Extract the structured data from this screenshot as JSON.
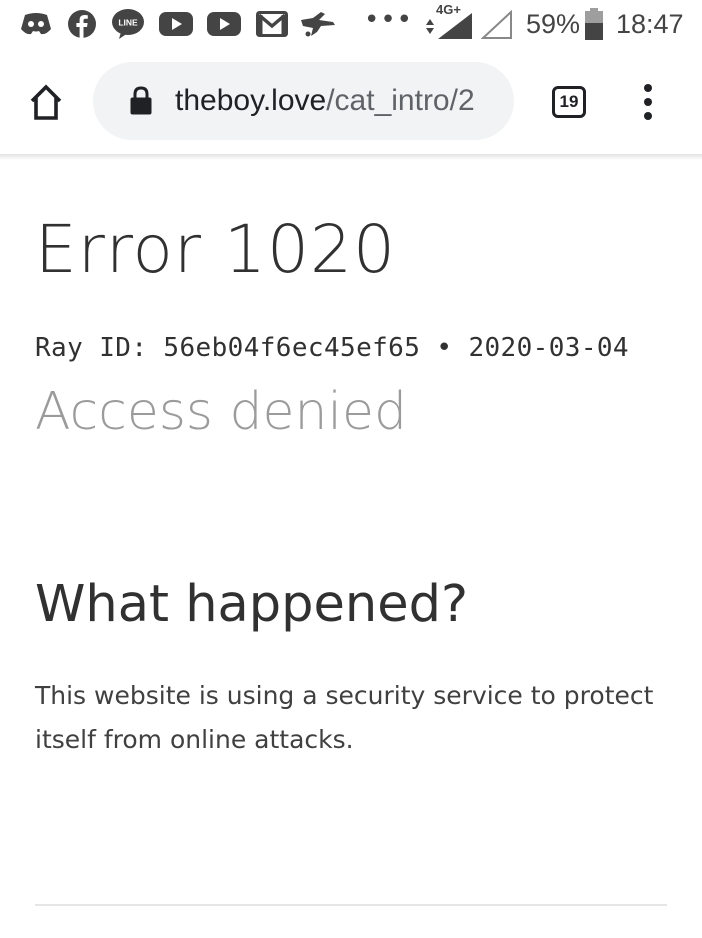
{
  "status_bar": {
    "network_type": "4G+",
    "battery": "59%",
    "time": "18:47",
    "overflow": "•••",
    "app_icons": [
      "discord-icon",
      "facebook-icon",
      "line-icon",
      "youtube-icon",
      "youtube-icon",
      "gmail-icon",
      "bird-app-icon"
    ]
  },
  "browser": {
    "url_domain": "theboy.love",
    "url_path": "/cat_intro/2",
    "tab_count": "19"
  },
  "page": {
    "error_title": "Error 1020",
    "ray_line": "Ray ID: 56eb04f6ec45ef65 • 2020-03-04",
    "access_denied": "Access denied",
    "what_happened": "What happened?",
    "explanation": "This website is using a security service to protect itself from online attacks."
  }
}
